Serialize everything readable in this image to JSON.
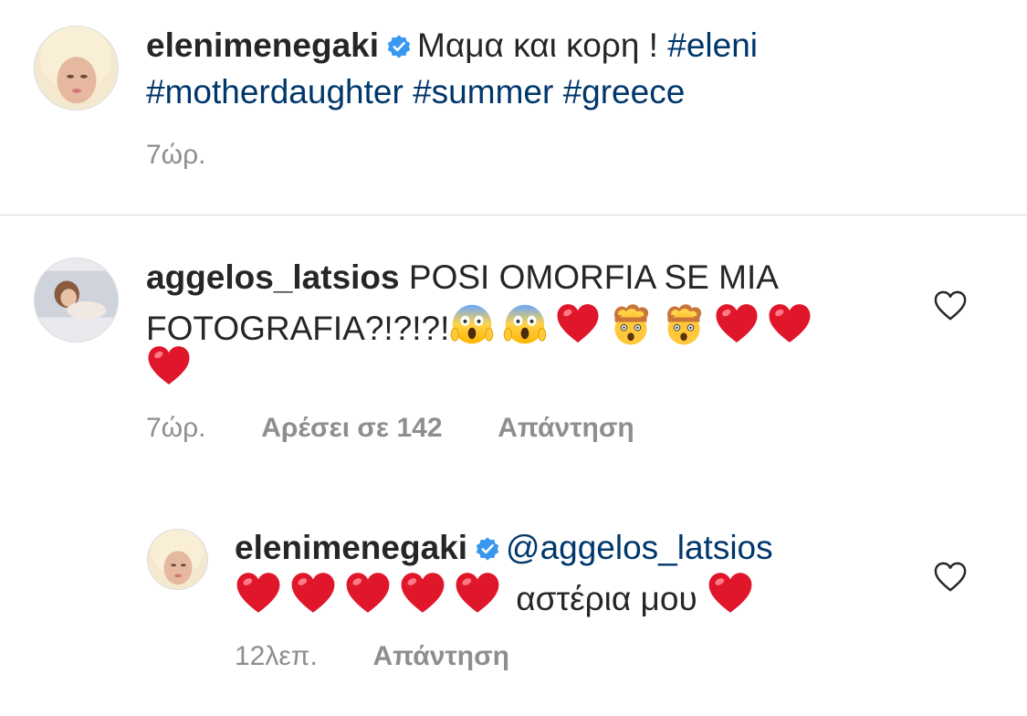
{
  "caption": {
    "username": "elenimenegaki",
    "text": "Μαμα και κορη !",
    "hashtags": [
      "#eleni",
      "#motherdaughter",
      "#summer",
      "#greece"
    ],
    "time": "7ώρ."
  },
  "comment": {
    "username": "aggelos_latsios",
    "text_line1": "POSI OMORFIA SE MIA",
    "text_line2": "FOTOGRAFIA?!?!?!",
    "emojis": [
      "scream-face",
      "scream-face",
      "red-heart",
      "exploding-head",
      "exploding-head",
      "red-heart",
      "red-heart",
      "red-heart"
    ],
    "time": "7ώρ.",
    "likes": "Αρέσει σε 142",
    "reply_label": "Απάντηση"
  },
  "reply": {
    "username": "elenimenegaki",
    "mention": "@aggelos_latsios",
    "emojis_before": [
      "red-heart",
      "red-heart",
      "red-heart",
      "red-heart",
      "red-heart"
    ],
    "text": "αστέρια μου",
    "emojis_after": [
      "red-heart"
    ],
    "time": "12λεπ.",
    "reply_label": "Απάντηση"
  },
  "colors": {
    "text": "#262626",
    "secondary": "#8e8e8e",
    "hashtag": "#00376b",
    "verified": "#3897f0",
    "divider": "#dbdbdb"
  },
  "icons": {
    "verified": "verified-badge-icon",
    "like": "heart-outline-icon"
  }
}
